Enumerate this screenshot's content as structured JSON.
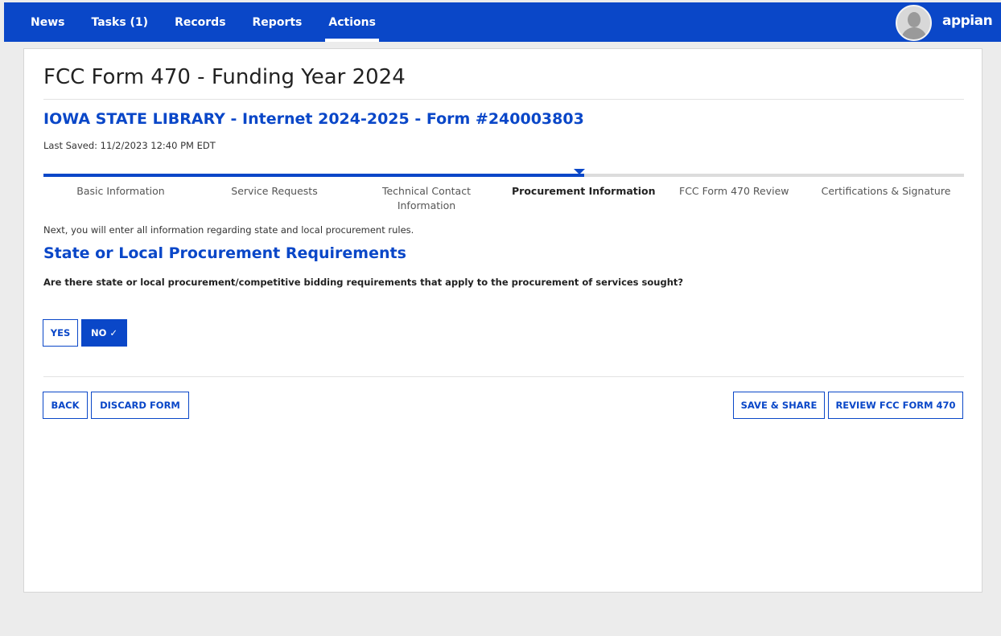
{
  "nav": {
    "items": [
      "News",
      "Tasks (1)",
      "Records",
      "Reports",
      "Actions"
    ],
    "active": "Actions"
  },
  "brand": "appian",
  "page_title": "FCC Form 470 - Funding Year 2024",
  "form_title": "IOWA STATE LIBRARY - Internet 2024-2025 - Form #240003803",
  "last_saved": "Last Saved: 11/2/2023 12:40 PM EDT",
  "steps": [
    {
      "line1": "Basic Information",
      "line2": ""
    },
    {
      "line1": "Service Requests",
      "line2": ""
    },
    {
      "line1": "Technical Contact",
      "line2": "Information"
    },
    {
      "line1": "Procurement Information",
      "line2": ""
    },
    {
      "line1": "FCC Form 470 Review",
      "line2": ""
    },
    {
      "line1": "Certifications & Signature",
      "line2": ""
    }
  ],
  "current_step": "Procurement Information",
  "intro_text": "Next, you will enter all information regarding state and local procurement rules.",
  "section_heading": "State or Local Procurement Requirements",
  "question": "Are there state or local procurement/competitive bidding requirements that apply to the procurement of services sought?",
  "answer": {
    "yes_label": "YES",
    "no_label": "NO ✓",
    "selected": "NO"
  },
  "buttons": {
    "back": "BACK",
    "discard": "DISCARD FORM",
    "save_share": "SAVE & SHARE",
    "review": "REVIEW FCC FORM 470"
  },
  "colors": {
    "accent": "#0a47c8",
    "page_background": "#ececec"
  }
}
